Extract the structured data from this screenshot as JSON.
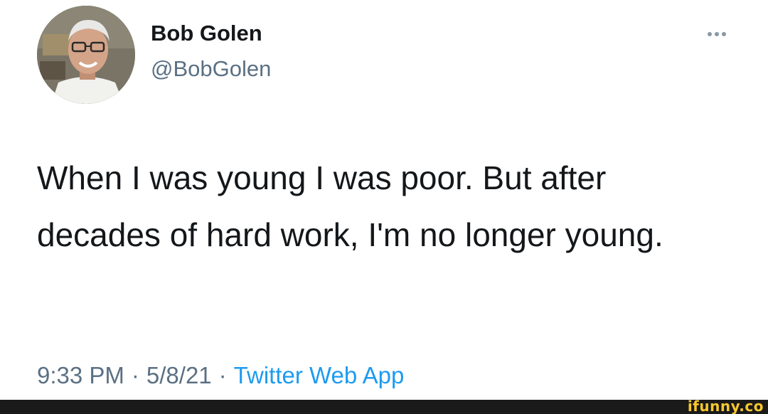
{
  "tweet": {
    "author_name": "Bob Golen",
    "author_handle": "@BobGolen",
    "text": "When I was young I was poor.  But after decades of hard work, I'm no longer young.",
    "time": "9:33 PM",
    "date": "5/8/21",
    "source": "Twitter Web App",
    "separator": "·"
  },
  "icons": {
    "more": "more-options-icon",
    "avatar": "profile-photo"
  },
  "watermark": {
    "text": "ifunny.co"
  },
  "colors": {
    "text_primary": "#14171a",
    "text_secondary": "#5b7083",
    "link": "#1d9bf0",
    "watermark": "#f7c82d",
    "bar": "#1a1a1a"
  }
}
